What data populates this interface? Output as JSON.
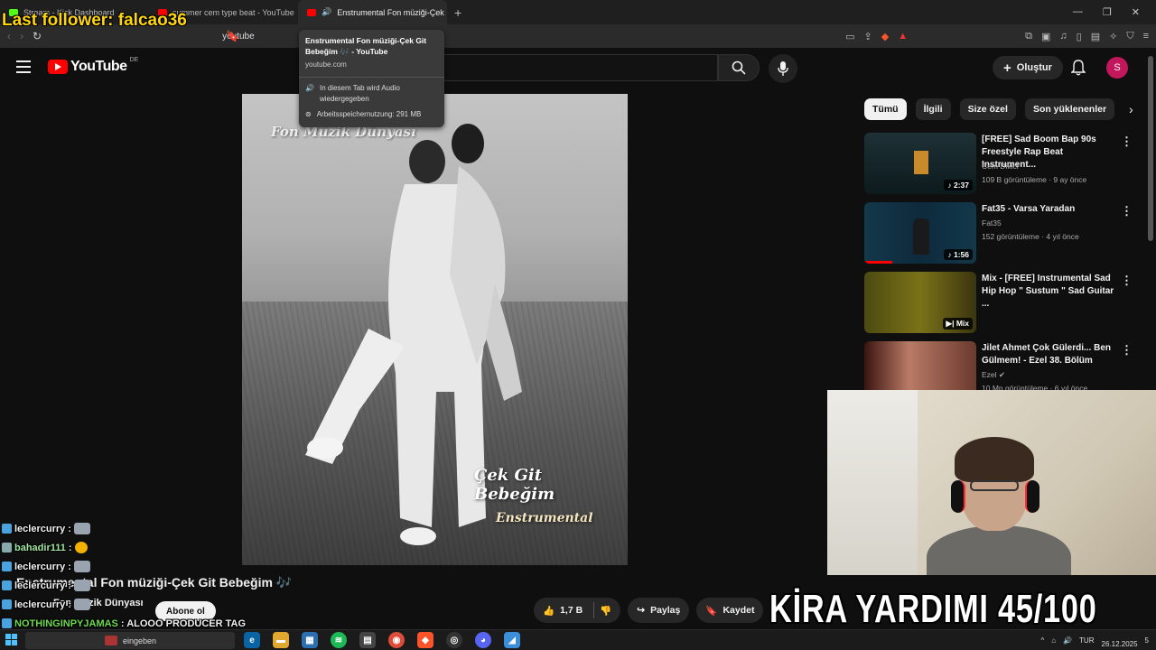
{
  "browser": {
    "tabs": [
      {
        "label": "Stream - Kick Dashboard",
        "color": "#53fc18"
      },
      {
        "label": "summer cem type beat - YouTube",
        "color": "#ff0000"
      },
      {
        "label": "Enstrumental Fon müziği-Çek",
        "color": "#ff0000",
        "active": true
      }
    ],
    "new_tab": "+",
    "url": "youtube",
    "tooltip": {
      "title": "Enstrumental Fon müziği-Çek Git Bebeğim 🎶 - YouTube",
      "domain": "youtube.com",
      "audio_note": "In diesem Tab wird Audio wiedergegeben",
      "memory": "Arbeitsspeichernutzung: 291 MB"
    }
  },
  "stream_overlay": {
    "last_follower": "Last follower: falcao36",
    "banner": "KİRA YARDIMI 45/100",
    "chat": [
      {
        "user": "leclercurry",
        "text": ":",
        "emote": "face",
        "user_color": "#f1f1f1"
      },
      {
        "user": "bahadir111",
        "text": ":",
        "emote": "sun",
        "user_color": "#a0e6a0"
      },
      {
        "user": "leclercurry",
        "text": ":",
        "emote": "face",
        "user_color": "#f1f1f1"
      },
      {
        "user": "leclercurry",
        "text": ":",
        "emote": "face",
        "user_color": "#f1f1f1"
      },
      {
        "user": "leclercurry",
        "text": ":",
        "emote": "face",
        "user_color": "#f1f1f1"
      },
      {
        "user": "NOTHINGINPYJAMAS",
        "text": ": ALOOO PRODUCER TAG",
        "emote": "",
        "user_color": "#6bdc4a"
      }
    ]
  },
  "youtube": {
    "logo": "YouTube",
    "country": "DE",
    "create_label": "Oluştur",
    "avatar_letter": "S",
    "video": {
      "watermark": "Fon Müzik Dünyası",
      "overlay_title": "Çek Git Bebeğim",
      "overlay_sub": "Enstrumental",
      "title": "Enstrumental Fon müziği-Çek Git Bebeğim 🎶",
      "channel": "Fon Müzik Dünyası",
      "subscribe": "Abone ol",
      "likes": "1,7 B",
      "share": "Paylaş",
      "save": "Kaydet"
    },
    "chips": [
      "Tümü",
      "İlgili",
      "Size özel",
      "Son yüklenenler"
    ],
    "recommendations": [
      {
        "title": "[FREE] Sad Boom Bap 90s Freestyle Rap Beat Instrument...",
        "channel": "Cem Dikici",
        "meta": "109 B görüntüleme · 9 ay önce",
        "duration": "2:37",
        "progress": 0
      },
      {
        "title": "Fat35 - Varsa Yaradan",
        "channel": "Fat35",
        "meta": "152 görüntüleme · 4 yıl önce",
        "duration": "1:56",
        "progress": 0.25
      },
      {
        "title": "Mix - [FREE] Instrumental Sad Hip Hop \" Sustum \" Sad Guitar ...",
        "channel": "",
        "meta": "",
        "duration": "Mix",
        "progress": 0
      },
      {
        "title": "Jilet Ahmet Çok Gülerdi... Ben Gülmem! - Ezel 38. Bölüm",
        "channel": "Ezel",
        "meta": "10 Mn görüntüleme · 6 yıl önce",
        "duration": "",
        "progress": 0
      }
    ]
  },
  "taskbar": {
    "search_text": "eingeben",
    "lang": "TUR",
    "date": "26.12.2025",
    "notifications": "5"
  }
}
